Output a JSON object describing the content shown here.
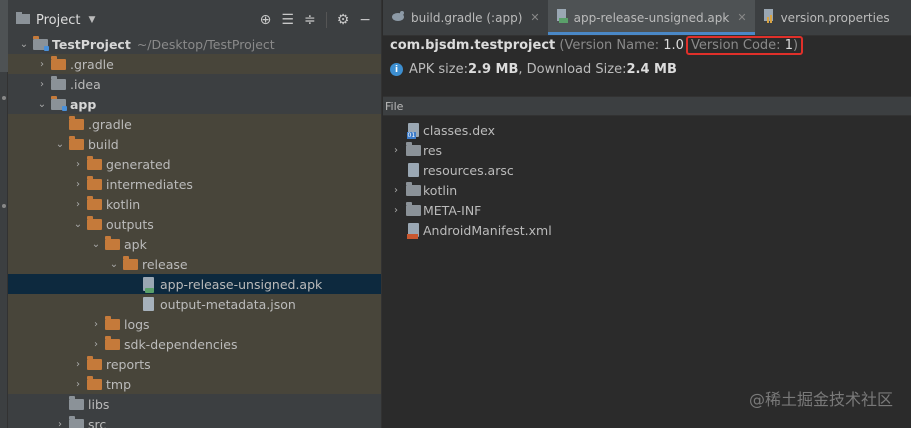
{
  "project_panel": {
    "title": "Project",
    "tools": [
      "locate-icon",
      "expand-all-icon",
      "collapse-all-icon",
      "gear-icon",
      "minimize-icon"
    ],
    "tree": [
      {
        "label": "TestProject",
        "hint": "~/Desktop/TestProject",
        "indent": 0,
        "arrow": "down",
        "icon": "module",
        "bold": true,
        "hl": false
      },
      {
        "label": ".gradle",
        "indent": 1,
        "arrow": "right",
        "icon": "folder",
        "hl": true
      },
      {
        "label": ".idea",
        "indent": 1,
        "arrow": "right",
        "icon": "folder-grey",
        "hl": false
      },
      {
        "label": "app",
        "indent": 1,
        "arrow": "down",
        "icon": "module",
        "bold": true,
        "hl": false
      },
      {
        "label": ".gradle",
        "indent": 2,
        "arrow": "",
        "icon": "folder",
        "hl": true
      },
      {
        "label": "build",
        "indent": 2,
        "arrow": "down",
        "icon": "folder",
        "hl": true
      },
      {
        "label": "generated",
        "indent": 3,
        "arrow": "right",
        "icon": "folder",
        "hl": true
      },
      {
        "label": "intermediates",
        "indent": 3,
        "arrow": "right",
        "icon": "folder",
        "hl": true
      },
      {
        "label": "kotlin",
        "indent": 3,
        "arrow": "right",
        "icon": "folder",
        "hl": true
      },
      {
        "label": "outputs",
        "indent": 3,
        "arrow": "down",
        "icon": "folder",
        "hl": true
      },
      {
        "label": "apk",
        "indent": 4,
        "arrow": "down",
        "icon": "folder",
        "hl": true
      },
      {
        "label": "release",
        "indent": 5,
        "arrow": "down",
        "icon": "folder",
        "hl": true
      },
      {
        "label": "app-release-unsigned.apk",
        "indent": 6,
        "arrow": "",
        "icon": "apk",
        "hl": false,
        "sel": true
      },
      {
        "label": "output-metadata.json",
        "indent": 6,
        "arrow": "",
        "icon": "json",
        "hl": true
      },
      {
        "label": "logs",
        "indent": 4,
        "arrow": "right",
        "icon": "folder",
        "hl": true
      },
      {
        "label": "sdk-dependencies",
        "indent": 4,
        "arrow": "right",
        "icon": "folder",
        "hl": true
      },
      {
        "label": "reports",
        "indent": 3,
        "arrow": "right",
        "icon": "folder",
        "hl": true
      },
      {
        "label": "tmp",
        "indent": 3,
        "arrow": "right",
        "icon": "folder",
        "hl": true
      },
      {
        "label": "libs",
        "indent": 2,
        "arrow": "",
        "icon": "folder-grey",
        "hl": false
      },
      {
        "label": "src",
        "indent": 2,
        "arrow": "right",
        "icon": "folder-grey",
        "hl": false
      }
    ]
  },
  "tabs": [
    {
      "label": "build.gradle (:app)",
      "icon": "gradle-icon",
      "active": false
    },
    {
      "label": "app-release-unsigned.apk",
      "icon": "apk-icon",
      "active": true
    },
    {
      "label": "version.properties",
      "icon": "properties-icon",
      "active": false,
      "partial": true
    }
  ],
  "apk": {
    "package": "com.bjsdm.testproject",
    "version_name_label": "(Version Name: ",
    "version_name": "1.0",
    "version_code_label": "Version Code: ",
    "version_code": "1",
    "close_paren": ")",
    "size_label": "APK size: ",
    "apk_size": "2.9 MB",
    "download_label": ", Download Size: ",
    "download_size": "2.4 MB"
  },
  "files_header": "File",
  "files": [
    {
      "label": "classes.dex",
      "arrow": "",
      "icon": "dex"
    },
    {
      "label": "res",
      "arrow": "right",
      "icon": "folder-grey"
    },
    {
      "label": "resources.arsc",
      "arrow": "",
      "icon": "arsc"
    },
    {
      "label": "kotlin",
      "arrow": "right",
      "icon": "folder-grey"
    },
    {
      "label": "META-INF",
      "arrow": "right",
      "icon": "folder-grey"
    },
    {
      "label": "AndroidManifest.xml",
      "arrow": "",
      "icon": "xml"
    }
  ],
  "watermark": "@稀土掘金技术社区"
}
